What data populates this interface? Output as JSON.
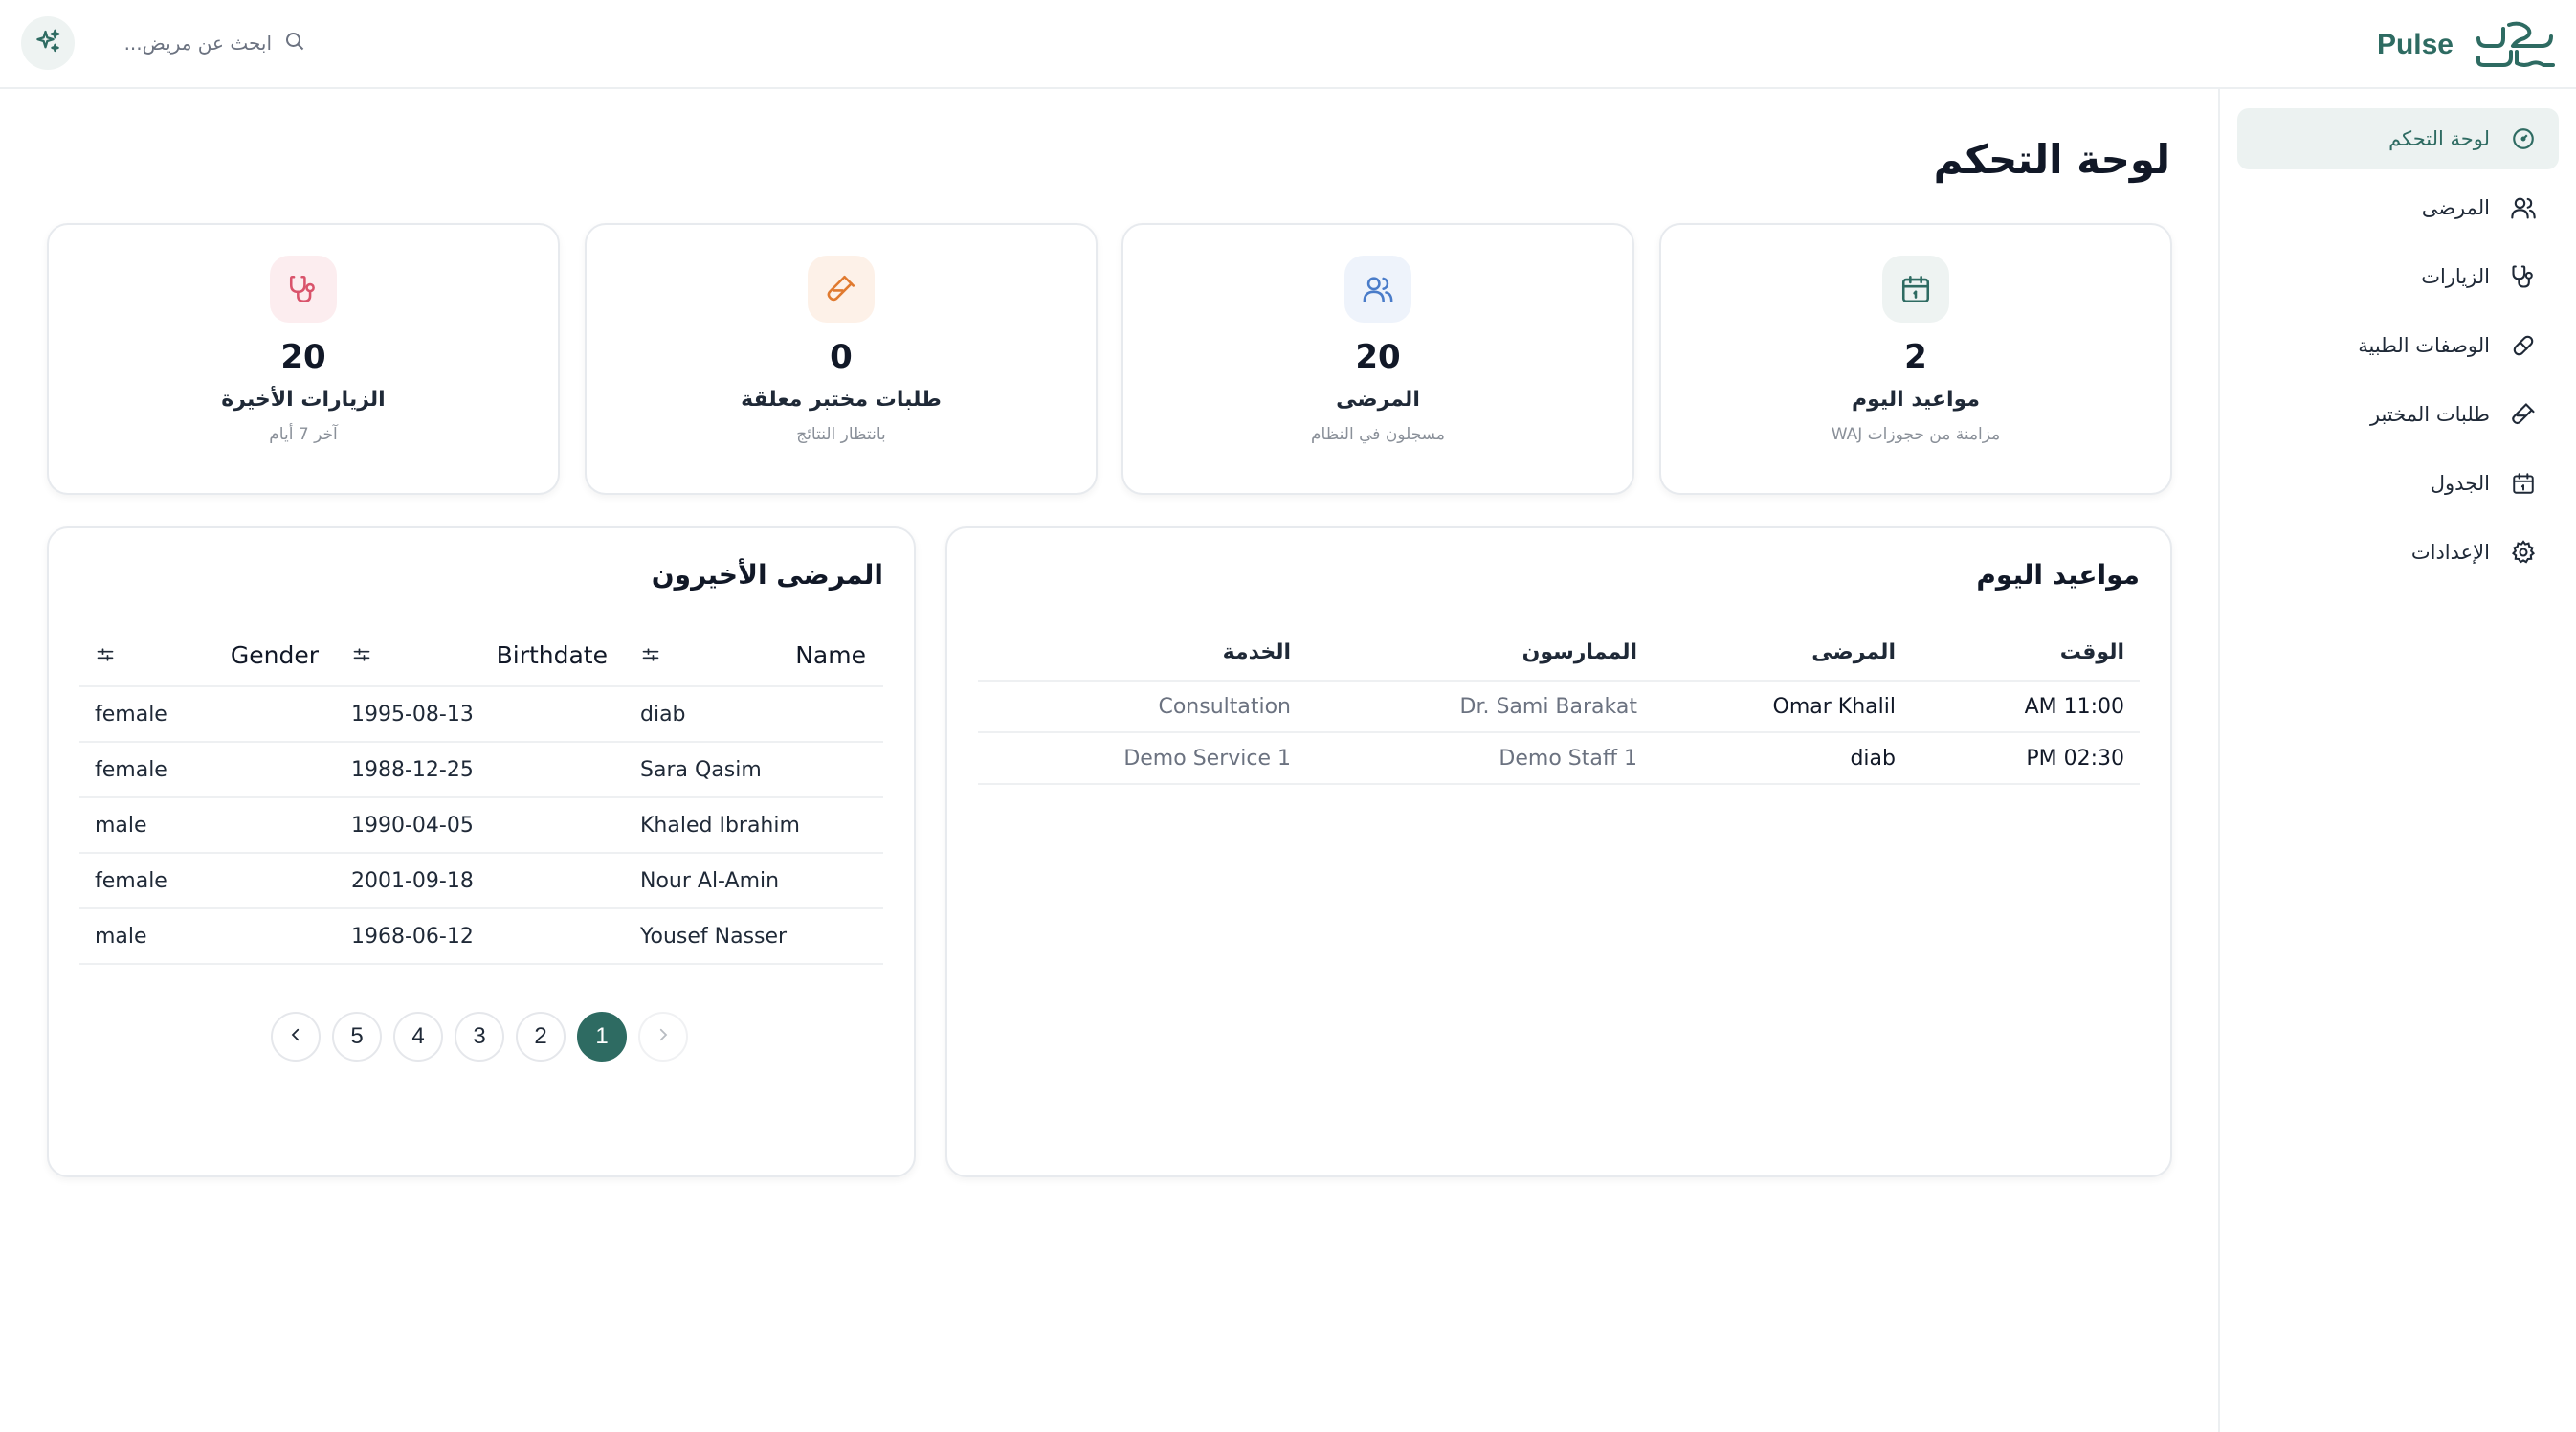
{
  "header": {
    "search_placeholder": "ابحث عن مريض...",
    "brand_name": "Pulse",
    "magic_icon": "sparkles-icon",
    "search_icon": "search-icon"
  },
  "sidebar": {
    "items": [
      {
        "label": "لوحة التحكم",
        "icon": "dashboard-gauge-icon",
        "active": true
      },
      {
        "label": "المرضى",
        "icon": "users-icon",
        "active": false
      },
      {
        "label": "الزيارات",
        "icon": "stethoscope-icon",
        "active": false
      },
      {
        "label": "الوصفات الطبية",
        "icon": "pill-icon",
        "active": false
      },
      {
        "label": "طلبات المختبر",
        "icon": "test-tube-icon",
        "active": false
      },
      {
        "label": "الجدول",
        "icon": "calendar-icon",
        "active": false
      },
      {
        "label": "الإعدادات",
        "icon": "gear-icon",
        "active": false
      }
    ]
  },
  "page": {
    "title": "لوحة التحكم"
  },
  "stats": [
    {
      "value": "2",
      "label": "مواعيد اليوم",
      "sub": "مزامنة من حجوزات WAJ",
      "icon": "calendar-icon",
      "color": "#2e6b62",
      "bg": "#eef3f2"
    },
    {
      "value": "20",
      "label": "المرضى",
      "sub": "مسجلون في النظام",
      "icon": "users-icon",
      "color": "#4a7cc9",
      "bg": "#eef3fb"
    },
    {
      "value": "0",
      "label": "طلبات مختبر معلقة",
      "sub": "بانتظار النتائج",
      "icon": "test-tube-icon",
      "color": "#e07a2f",
      "bg": "#fdf1e8"
    },
    {
      "value": "20",
      "label": "الزيارات الأخيرة",
      "sub": "آخر 7 أيام",
      "icon": "stethoscope-icon",
      "color": "#d9536b",
      "bg": "#fcedef"
    }
  ],
  "appointments": {
    "title": "مواعيد اليوم",
    "headers": [
      "الوقت",
      "المرضى",
      "الممارسون",
      "الخدمة"
    ],
    "rows": [
      [
        "11:00 AM",
        "Omar Khalil",
        "Dr. Sami Barakat",
        "Consultation"
      ],
      [
        "02:30 PM",
        "diab",
        "Demo Staff 1",
        "Demo Service 1"
      ]
    ]
  },
  "patients": {
    "title": "المرضى الأخيرون",
    "headers": {
      "gender": "Gender",
      "birthdate": "Birthdate",
      "name": "Name"
    },
    "rows": [
      {
        "gender": "female",
        "birthdate": "1995-08-13",
        "name": "diab"
      },
      {
        "gender": "female",
        "birthdate": "1988-12-25",
        "name": "Sara Qasim"
      },
      {
        "gender": "male",
        "birthdate": "1990-04-05",
        "name": "Khaled Ibrahim"
      },
      {
        "gender": "female",
        "birthdate": "2001-09-18",
        "name": "Nour Al-Amin"
      },
      {
        "gender": "male",
        "birthdate": "1968-06-12",
        "name": "Yousef Nasser"
      }
    ],
    "pagination": {
      "pages": [
        "5",
        "4",
        "3",
        "2",
        "1"
      ],
      "current": "1",
      "prev_icon": "chevron-left-icon",
      "next_icon": "chevron-right-icon"
    }
  },
  "colors": {
    "accent": "#2e6b62",
    "accent_bg": "#ecf2f1"
  }
}
